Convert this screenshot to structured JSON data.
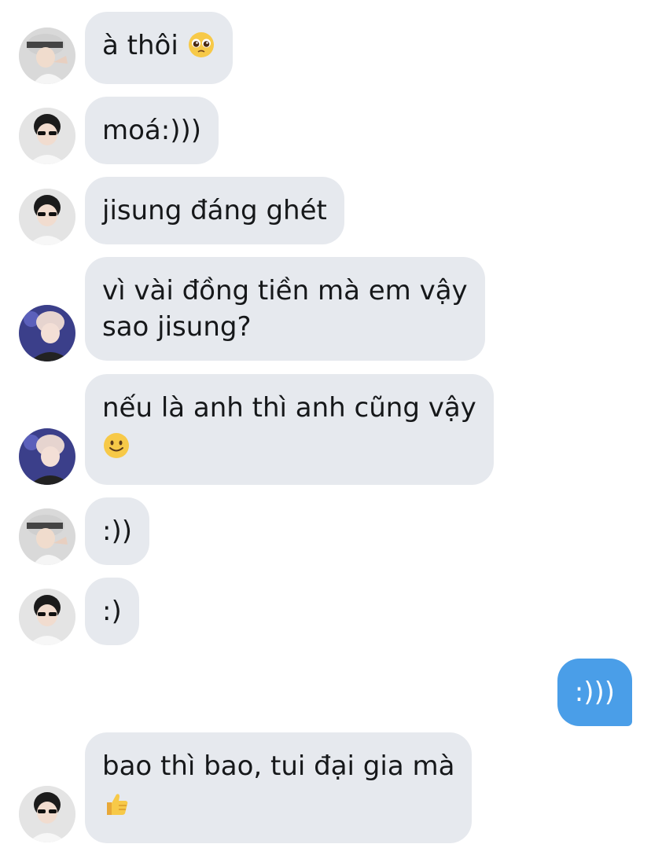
{
  "chat": {
    "messages": [
      {
        "sender": "user-a",
        "direction": "incoming",
        "lines": [
          "à thôi"
        ],
        "emoji": "pleading-face-icon"
      },
      {
        "sender": "user-b",
        "direction": "incoming",
        "lines": [
          "moá:)))"
        ]
      },
      {
        "sender": "user-b",
        "direction": "incoming",
        "lines": [
          "jisung đáng ghét"
        ]
      },
      {
        "sender": "user-c",
        "direction": "incoming",
        "lines": [
          "vì vài đồng tiền mà em vậy",
          "sao jisung?"
        ]
      },
      {
        "sender": "user-c",
        "direction": "incoming",
        "lines": [
          "nếu là anh thì anh cũng vậy"
        ],
        "emoji": "slightly-smiling-face-icon"
      },
      {
        "sender": "user-a",
        "direction": "incoming",
        "lines": [
          ":))"
        ]
      },
      {
        "sender": "user-b",
        "direction": "incoming",
        "lines": [
          ":)"
        ]
      },
      {
        "sender": "me",
        "direction": "outgoing",
        "lines": [
          ":)))"
        ]
      },
      {
        "sender": "user-b",
        "direction": "incoming",
        "lines": [
          "bao thì bao, tui đại gia mà"
        ],
        "emoji": "thumbs-up-icon"
      }
    ]
  },
  "colors": {
    "incoming_bubble": "#e6e9ee",
    "outgoing_bubble": "#4a9ee8",
    "incoming_text": "#16181a",
    "outgoing_text": "#ffffff"
  }
}
